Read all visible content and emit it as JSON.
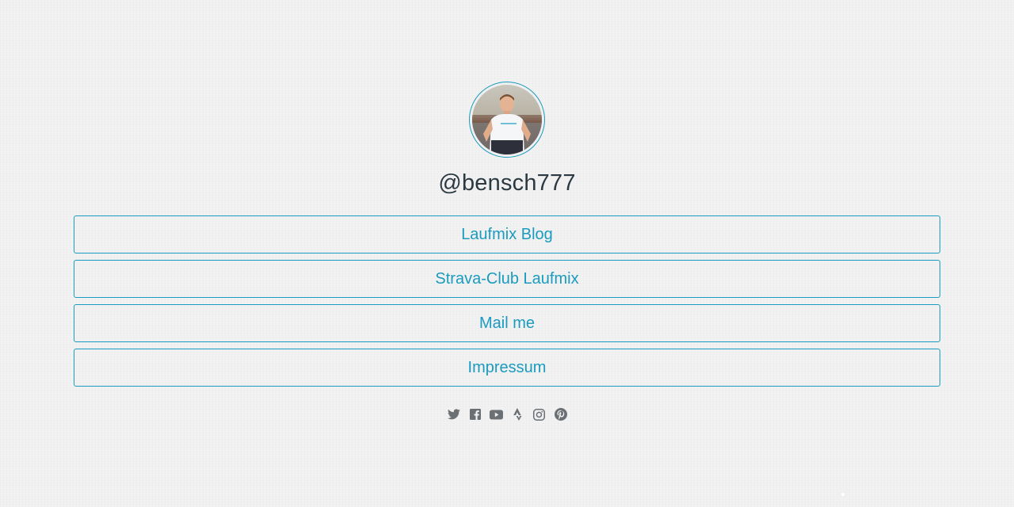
{
  "profile": {
    "username": "@bensch777",
    "avatar_alt": "profile photo"
  },
  "links": [
    {
      "label": "Laufmix Blog"
    },
    {
      "label": "Strava-Club Laufmix"
    },
    {
      "label": "Mail me"
    },
    {
      "label": "Impressum"
    }
  ],
  "socials": [
    {
      "icon": "twitter-icon"
    },
    {
      "icon": "facebook-icon"
    },
    {
      "icon": "youtube-icon"
    },
    {
      "icon": "strava-icon"
    },
    {
      "icon": "instagram-icon"
    },
    {
      "icon": "pinterest-icon"
    }
  ],
  "colors": {
    "accent": "#1a9bbf",
    "text": "#2b3a42",
    "icon": "#6b7075",
    "background": "#f2f2f2"
  }
}
